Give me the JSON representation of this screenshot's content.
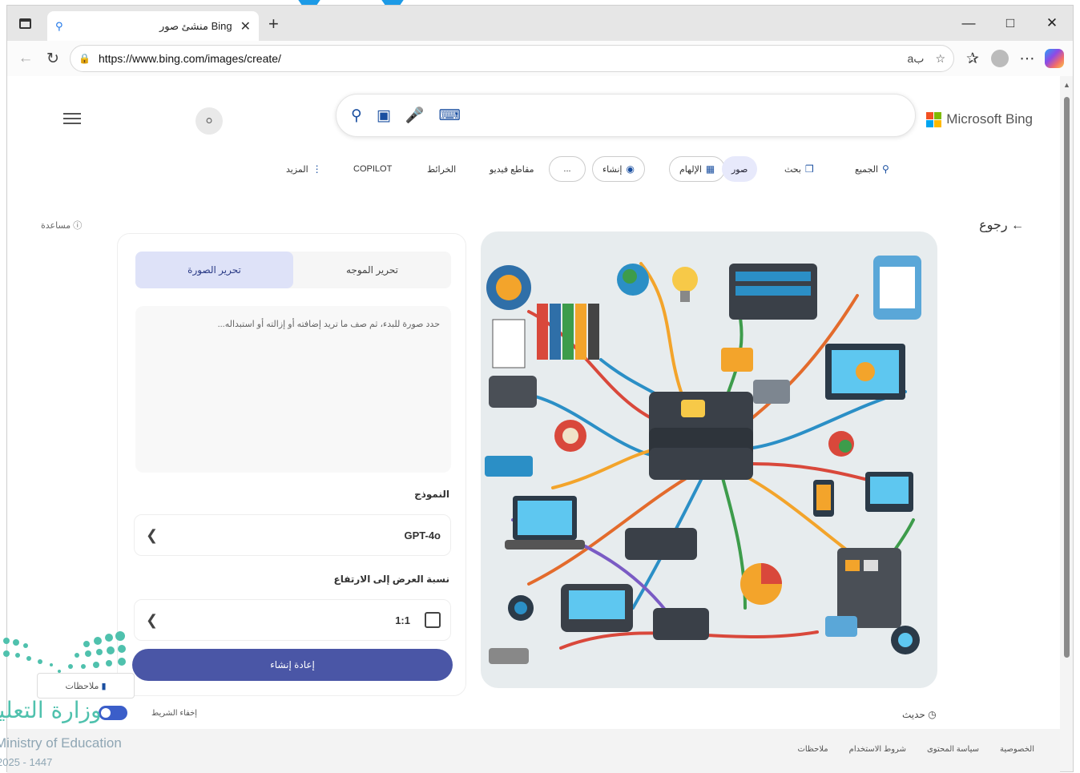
{
  "browser": {
    "tab_title": "منشئ صور Bing",
    "url": "https://www.bing.com/images/create/"
  },
  "header": {
    "logo_text": "Microsoft Bing"
  },
  "nav": {
    "all": "الجميع",
    "search": "بحث",
    "images": "صور",
    "inspire": "الإلهام",
    "create": "إنشاء",
    "more_dots": "...",
    "videos": "مقاطع فيديو",
    "maps": "الخرائط",
    "copilot": "COPILOT",
    "more": "المزيد"
  },
  "help": "مساعدة",
  "back": "رجوع",
  "panel": {
    "tab_edit_prompt": "تحرير الموجه",
    "tab_edit_image": "تحرير الصورة",
    "prompt_placeholder": "حدد صورة للبدء، ثم صف ما تريد إضافته أو إزالته أو استبداله...",
    "model_label": "النموذج",
    "model_value": "GPT-4o",
    "ratio_label": "نسبة العرض إلى الارتفاع",
    "ratio_value": "1:1",
    "regenerate_button": "إعادة إنشاء"
  },
  "hide_bar": "إخفاء الشريط",
  "recent": "حديث",
  "footer": {
    "privacy": "الخصوصية",
    "content_policy": "سياسة المحتوى",
    "terms": "شروط الاستخدام",
    "feedback": "ملاحظات"
  },
  "feedback_button": "ملاحظات",
  "watermark": {
    "arabic": "وزارة التعليم",
    "english": "Ministry of Education",
    "year": "2025 - 1447"
  },
  "colors": {
    "accent": "#4a56a6",
    "active_pill": "#e7e9fb",
    "toggle": "#3b5ec9"
  }
}
